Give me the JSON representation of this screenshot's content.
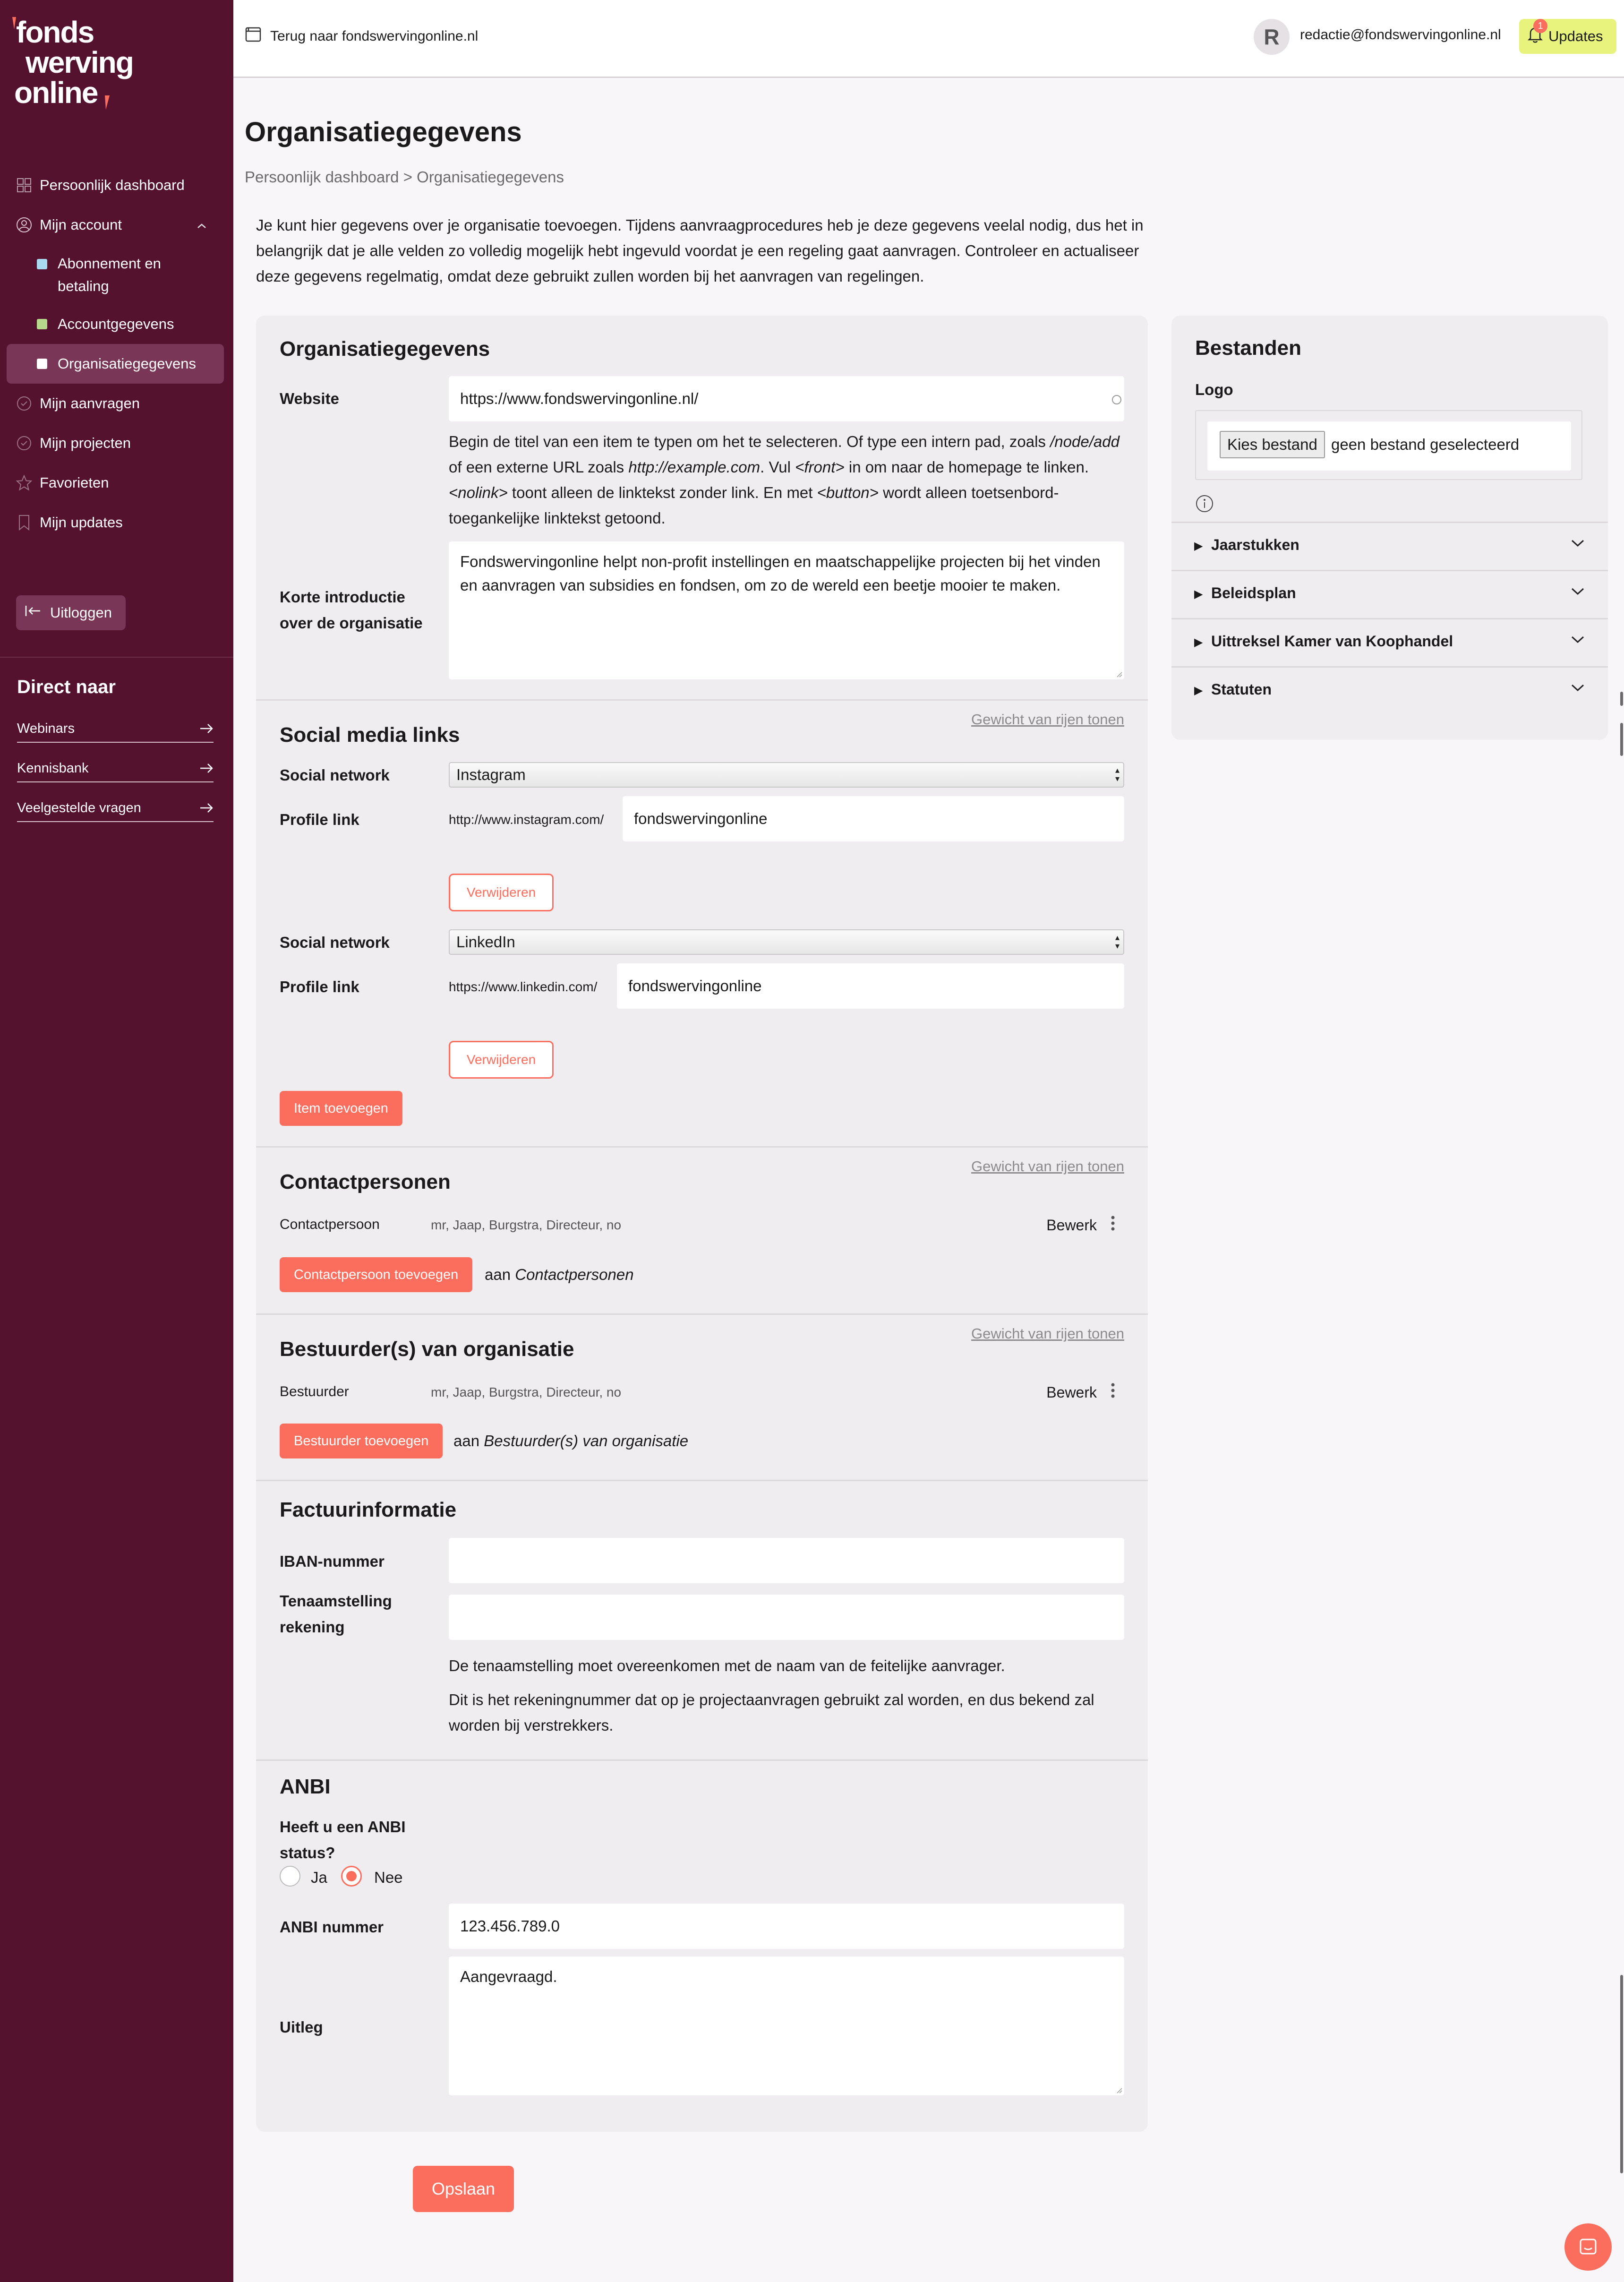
{
  "brand": {
    "logo_lines": [
      "fonds",
      "werving",
      "online"
    ],
    "accent": "#fb6e5e",
    "sidebar_bg": "#55122f",
    "updates_bg": "#e8f37e"
  },
  "sidebar": {
    "nav": [
      {
        "label": "Persoonlijk dashboard",
        "icon": "grid-icon"
      },
      {
        "label": "Mijn account",
        "icon": "user-circle-icon"
      },
      {
        "label": "Abonnement en betaling",
        "icon": "square-icon"
      },
      {
        "label": "Accountgegevens",
        "icon": "square-icon"
      },
      {
        "label": "Organisatiegegevens",
        "icon": "square-icon"
      },
      {
        "label": "Mijn aanvragen",
        "icon": "check-circle-icon"
      },
      {
        "label": "Mijn projecten",
        "icon": "check-circle-icon"
      },
      {
        "label": "Favorieten",
        "icon": "star-icon"
      },
      {
        "label": "Mijn updates",
        "icon": "bookmark-icon"
      }
    ],
    "logout_label": "Uitloggen",
    "direct_title": "Direct naar",
    "direct_links": [
      "Webinars",
      "Kennisbank",
      "Veelgestelde vragen"
    ]
  },
  "topbar": {
    "back_label": "Terug naar fondswervingonline.nl",
    "avatar_initial": "R",
    "user_email": "redactie@fondswervingonline.nl",
    "updates_label": "Updates",
    "updates_count": "1"
  },
  "page": {
    "title": "Organisatiegegevens",
    "breadcrumb": "Persoonlijk dashboard > Organisatiegegevens",
    "intro": "Je kunt hier gegevens over je organisatie toevoegen. Tijdens aanvraagprocedures heb je deze gegevens veelal nodig, dus het in belangrijk dat je alle velden zo volledig mogelijk hebt ingevuld voordat je een regeling gaat aanvragen. Controleer en actualiseer deze gegevens regelmatig, omdat deze gebruikt zullen worden bij het aanvragen van regelingen."
  },
  "org": {
    "title": "Organisatiegegevens",
    "website_label": "Website",
    "website_value": "https://www.fondswervingonline.nl/",
    "website_help_1": "Begin de titel van een item te typen om het te selecteren. Of type een intern pad, zoals ",
    "website_help_2": "/node/add",
    "website_help_3": " of een externe URL zoals ",
    "website_help_4": "http://example.com",
    "website_help_5": ". Vul ",
    "website_help_6": "<front>",
    "website_help_7": " in om naar de homepage te linken. ",
    "website_help_8": "<nolink>",
    "website_help_9": " toont alleen de linktekst zonder link. En met ",
    "website_help_10": "<button>",
    "website_help_11": " wordt alleen toetsenbord-toegankelijke linktekst getoond.",
    "intro_label": "Korte introductie over de organisatie",
    "intro_value": "Fondswervingonline helpt non-profit instellingen en maatschappelijke projecten bij het vinden en aanvragen van subsidies en fondsen, om zo de wereld een beetje mooier te maken."
  },
  "social": {
    "title": "Social media links",
    "weight_link": "Gewicht van rijen tonen",
    "network_label": "Social network",
    "profile_label": "Profile link",
    "remove_label": "Verwijderen",
    "add_label": "Item toevoegen",
    "items": [
      {
        "network": "Instagram",
        "prefix": "http://www.instagram.com/",
        "value": "fondswervingonline"
      },
      {
        "network": "LinkedIn",
        "prefix": "https://www.linkedin.com/",
        "value": "fondswervingonline"
      }
    ]
  },
  "contacts": {
    "title": "Contactpersonen",
    "weight_link": "Gewicht van rijen tonen",
    "row_label": "Contactpersoon",
    "row_values": "mr, Jaap, Burgstra, Directeur, no",
    "edit_label": "Bewerk",
    "add_label": "Contactpersoon toevoegen",
    "aan": "aan ",
    "aan_target": "Contactpersonen"
  },
  "board": {
    "title": "Bestuurder(s) van organisatie",
    "weight_link": "Gewicht van rijen tonen",
    "row_label": "Bestuurder",
    "row_values": "mr, Jaap, Burgstra, Directeur, no",
    "edit_label": "Bewerk",
    "add_label": "Bestuurder toevoegen",
    "aan": "aan ",
    "aan_target": "Bestuurder(s) van organisatie"
  },
  "invoice": {
    "title": "Factuurinformatie",
    "iban_label": "IBAN-nummer",
    "iban_value": "",
    "holder_label": "Tenaamstelling rekening",
    "holder_value": "",
    "help_1": "De tenaamstelling moet overeenkomen met de naam van de feitelijke aanvrager.",
    "help_2": "Dit is het rekeningnummer dat op je projectaanvragen gebruikt zal worden, en dus bekend zal worden bij verstrekkers."
  },
  "anbi": {
    "title": "ANBI",
    "question": "Heeft u een ANBI status?",
    "options": [
      "Ja",
      "Nee"
    ],
    "selected": "Nee",
    "number_label": "ANBI nummer",
    "number_value": "123.456.789.0",
    "explain_label": "Uitleg",
    "explain_value": "Aangevraagd."
  },
  "save_label": "Opslaan",
  "files": {
    "title": "Bestanden",
    "logo_label": "Logo",
    "choose_label": "Kies bestand",
    "none_label": "geen bestand geselecteerd",
    "accordions": [
      "Jaarstukken",
      "Beleidsplan",
      "Uittreksel Kamer van Koophandel",
      "Statuten"
    ]
  }
}
